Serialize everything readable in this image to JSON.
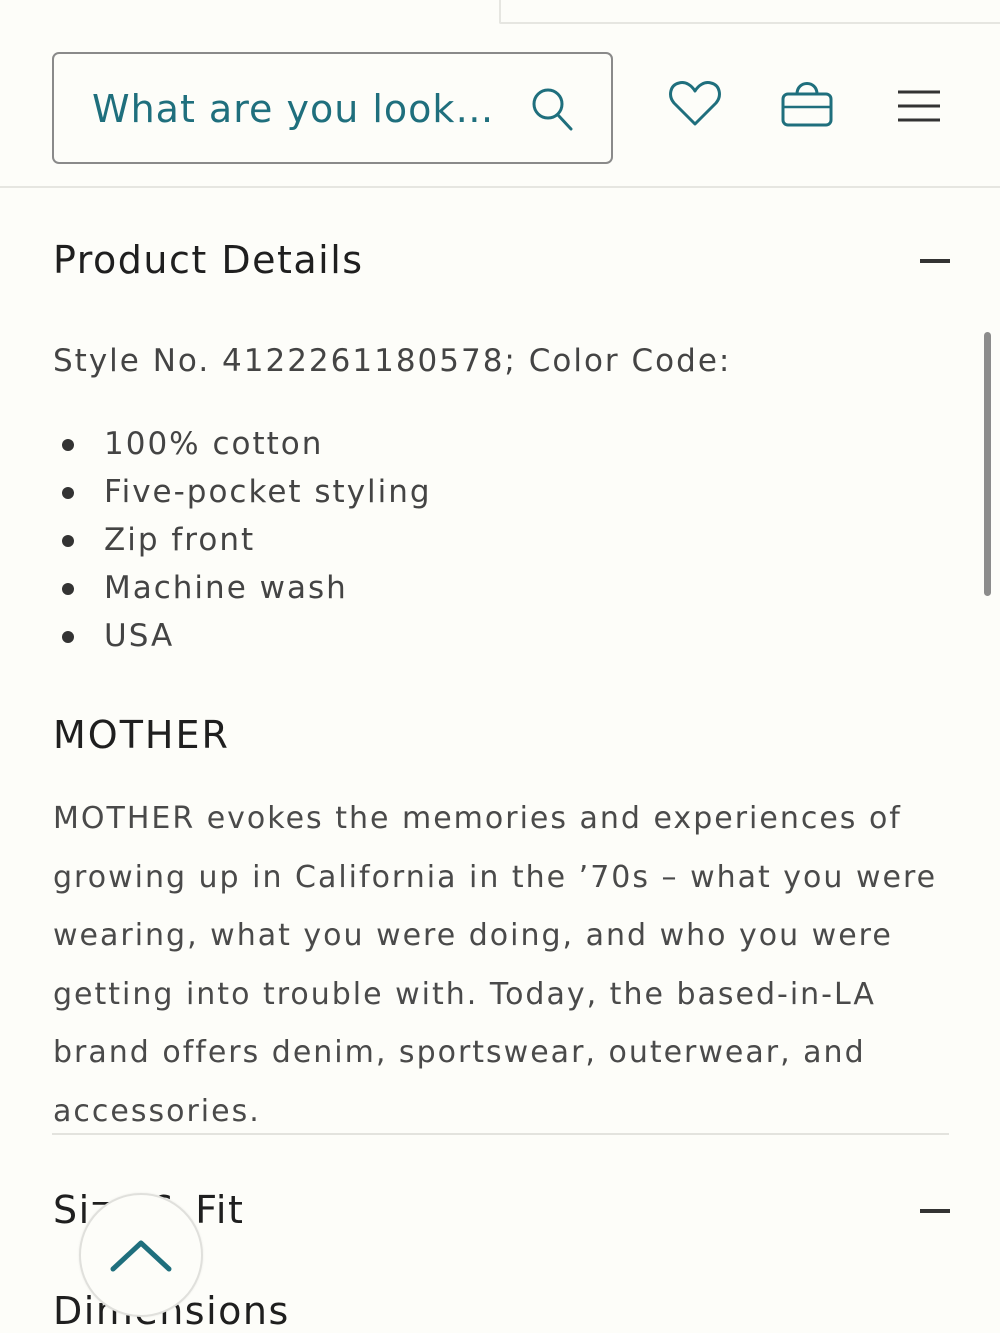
{
  "header": {
    "search": {
      "placeholder": "What are you look…",
      "value": ""
    },
    "icons": [
      "search-icon",
      "heart-icon",
      "shopping-bag-icon",
      "hamburger-menu-icon"
    ]
  },
  "product_details": {
    "title": "Product Details",
    "style_line": "Style No. 4122261180578; Color Code:",
    "bullets": [
      "100% cotton",
      "Five-pocket styling",
      "Zip front",
      "Machine wash",
      "USA"
    ],
    "brand": {
      "title": "MOTHER",
      "description": "MOTHER evokes the memories and experiences of growing up in California in the ’70s – what you were wearing, what you were doing, and who you were getting into trouble with. Today, the based-in-LA brand offers denim, sportswear, outerwear, and accessories."
    }
  },
  "size_fit": {
    "title": "Size & Fit",
    "subtitle": "Dimensions"
  },
  "colors": {
    "accent": "#1f6f7d",
    "text": "#333333",
    "background": "#fdfdf9"
  }
}
